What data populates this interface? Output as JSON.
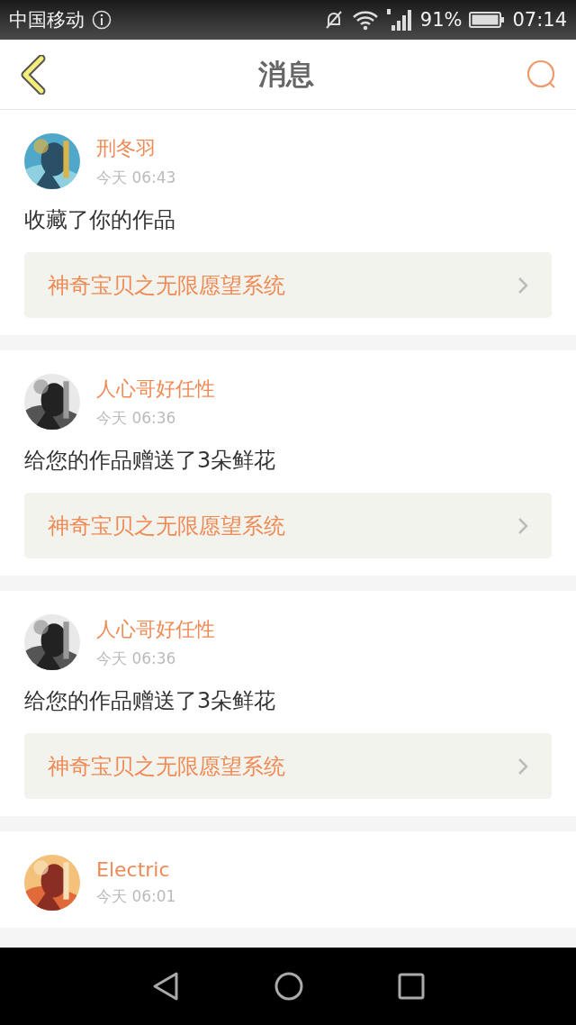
{
  "status_bar": {
    "carrier": "中国移动",
    "battery": "91%",
    "time": "07:14"
  },
  "header": {
    "title": "消息"
  },
  "messages": [
    {
      "user": "刑冬羽",
      "time": "今天 06:43",
      "text": "收藏了你的作品",
      "work": "神奇宝贝之无限愿望系统"
    },
    {
      "user": "人心哥好任性",
      "time": "今天 06:36",
      "text": "给您的作品赠送了3朵鲜花",
      "work": "神奇宝贝之无限愿望系统"
    },
    {
      "user": "人心哥好任性",
      "time": "今天 06:36",
      "text": "给您的作品赠送了3朵鲜花",
      "work": "神奇宝贝之无限愿望系统"
    },
    {
      "user": "Electric",
      "time": "今天 06:01"
    }
  ]
}
